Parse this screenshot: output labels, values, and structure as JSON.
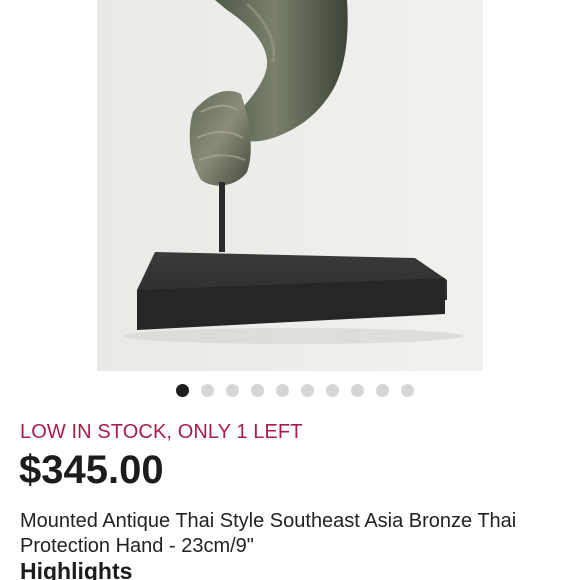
{
  "product": {
    "image_alt": "Mounted Antique Thai Style Southeast Asia Bronze Thai Protection Hand",
    "carousel": {
      "total": 10,
      "active_index": 0
    },
    "stock_label": "LOW IN STOCK, ONLY 1 LEFT",
    "price": "$345.00",
    "title": "Mounted Antique Thai Style Southeast Asia Bronze Thai Protection Hand - 23cm/9\"",
    "highlights_heading": "Highlights"
  },
  "colors": {
    "stock_accent": "#a81d4d",
    "dot_active": "#1c1c1c",
    "dot_inactive": "#d6d6d6"
  }
}
